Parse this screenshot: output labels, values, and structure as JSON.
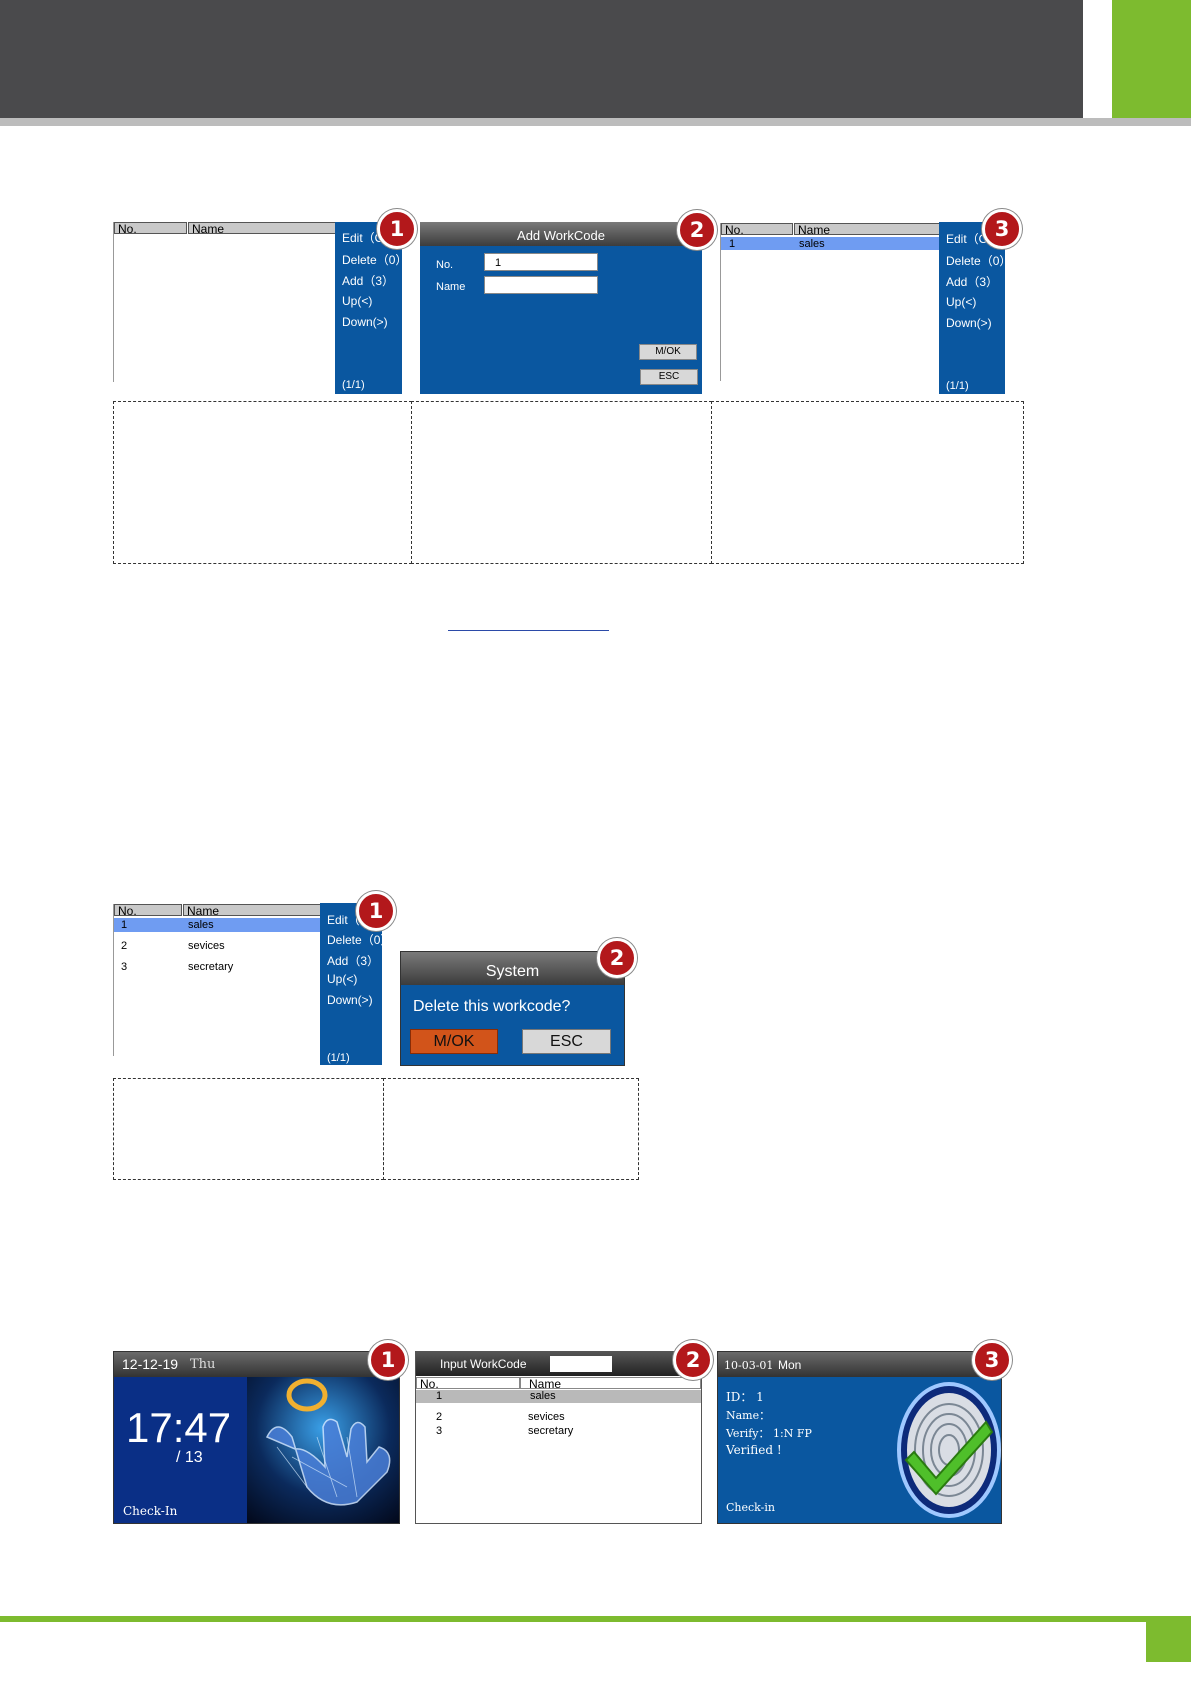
{
  "badges": [
    "1",
    "2",
    "3"
  ],
  "fig1": {
    "list1": {
      "col_no": "No.",
      "col_name": "Name",
      "menu": [
        "Edit（O",
        "Delete（0）",
        "Add（3）",
        "Up(<)",
        "Down(>)"
      ],
      "page": "(1/1)"
    },
    "add_dialog": {
      "title": "Add WorkCode",
      "no_label": "No.",
      "no_value": "1",
      "name_label": "Name",
      "name_value": "",
      "ok": "M/OK",
      "esc": "ESC"
    },
    "list3": {
      "col_no": "No.",
      "col_name": "Name",
      "row_no": "1",
      "row_name": "sales",
      "menu": [
        "Edit（O",
        "Delete（0）",
        "Add（3）",
        "Up(<)",
        "Down(>)"
      ],
      "page": "(1/1)"
    }
  },
  "fig2": {
    "list": {
      "col_no": "No.",
      "col_name": "Name",
      "rows": [
        {
          "no": "1",
          "name": "sales"
        },
        {
          "no": "2",
          "name": "sevices"
        },
        {
          "no": "3",
          "name": "secretary"
        }
      ],
      "menu": [
        "Edit（O",
        "Delete（0）",
        "Add（3）",
        "Up(<)",
        "Down(>)"
      ],
      "page": "(1/1)"
    },
    "system_dialog": {
      "title": "System",
      "message": "Delete this workcode?",
      "ok": "M/OK",
      "esc": "ESC"
    }
  },
  "fig3": {
    "clock": {
      "date": "12-12-19",
      "day": "Thu",
      "time": "17:47",
      "sub": "/ 13",
      "status": "Check-In"
    },
    "input": {
      "title": "Input WorkCode",
      "col_no": "No.",
      "col_name": "Name",
      "rows": [
        {
          "no": "1",
          "name": "sales"
        },
        {
          "no": "2",
          "name": "sevices"
        },
        {
          "no": "3",
          "name": "secretary"
        }
      ]
    },
    "verify": {
      "date": "10-03-01",
      "day": "Mon",
      "id_line": "ID： 1",
      "name_line": "Name：",
      "verify_line": "Verify： 1:N FP",
      "result": "Verified !",
      "status": "Check-in"
    }
  },
  "colors": {
    "header_dark": "#4a4a4c",
    "accent_green": "#7dbb2f",
    "screen_blue": "#0a57a0",
    "highlight_row": "#6f9cf2",
    "badge_red": "#b3181b",
    "ok_orange": "#d2541a"
  }
}
